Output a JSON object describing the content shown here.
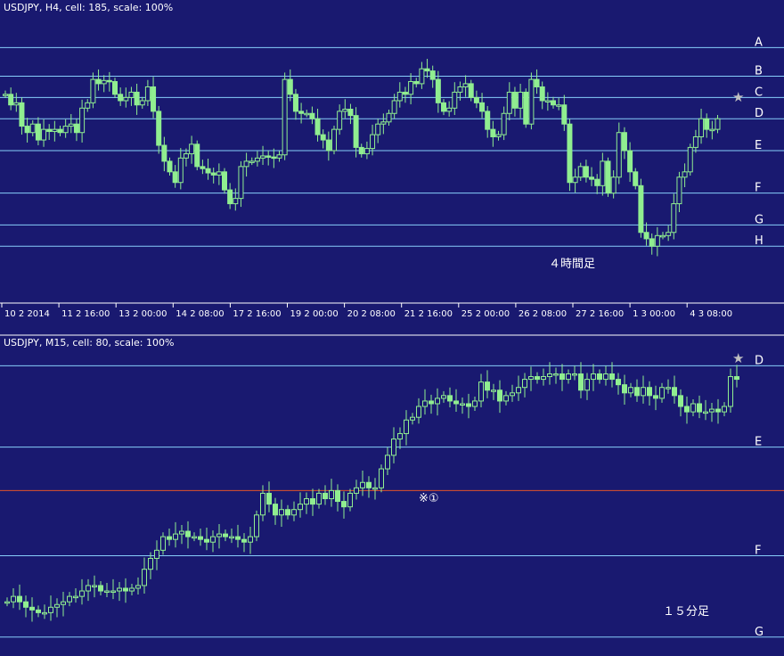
{
  "background_color": "#191970",
  "level_line_color": "#87cefa",
  "candle_color": "#90ee90",
  "star_color": "#c0c0c0",
  "marker_line_color": "#e0522a",
  "chart_data": [
    {
      "type": "candlestick",
      "header": "USDJPY, H4, cell: 185, scale: 100%",
      "annotation": "４時間足",
      "star": "★",
      "levels": [
        {
          "label": "A",
          "y": 0.92
        },
        {
          "label": "B",
          "y": 0.65
        },
        {
          "label": "C",
          "y": 0.45
        },
        {
          "label": "D",
          "y": 0.25
        },
        {
          "label": "E",
          "y": -0.05
        },
        {
          "label": "F",
          "y": -0.45
        },
        {
          "label": "G",
          "y": -0.75
        },
        {
          "label": "H",
          "y": -0.95
        }
      ],
      "ylim": [
        -1.25,
        1.2
      ],
      "x_labels": [
        "10 2 2014",
        "11 2 16:00",
        "13 2 00:00",
        "14 2 08:00",
        "17 2 16:00",
        "19 2 00:00",
        "20 2 08:00",
        "21 2 16:00",
        "25 2 00:00",
        "26 2 08:00",
        "27 2 16:00",
        "1 3 00:00",
        "4 3 08:00"
      ],
      "closes": [
        0.48,
        0.38,
        0.4,
        0.18,
        0.12,
        0.2,
        0.05,
        0.15,
        0.13,
        0.15,
        0.12,
        0.18,
        0.2,
        0.12,
        0.35,
        0.4,
        0.62,
        0.58,
        0.61,
        0.6,
        0.48,
        0.42,
        0.45,
        0.5,
        0.38,
        0.42,
        0.55,
        0.32,
        0.0,
        -0.15,
        -0.25,
        -0.35,
        -0.12,
        -0.08,
        0.01,
        -0.2,
        -0.22,
        -0.26,
        -0.28,
        -0.25,
        -0.42,
        -0.55,
        -0.5,
        -0.2,
        -0.15,
        -0.15,
        -0.12,
        -0.1,
        -0.11,
        -0.12,
        -0.09,
        0.62,
        0.48,
        0.32,
        0.3,
        0.3,
        0.25,
        0.1,
        0.05,
        -0.05,
        0.15,
        0.32,
        0.34,
        0.28,
        -0.02,
        -0.08,
        -0.03,
        0.1,
        0.2,
        0.22,
        0.3,
        0.42,
        0.5,
        0.48,
        0.6,
        0.58,
        0.72,
        0.7,
        0.62,
        0.4,
        0.32,
        0.35,
        0.5,
        0.55,
        0.58,
        0.45,
        0.4,
        0.32,
        0.15,
        0.08,
        0.1,
        0.3,
        0.5,
        0.35,
        0.5,
        0.2,
        0.62,
        0.55,
        0.42,
        0.42,
        0.38,
        0.38,
        0.2,
        -0.35,
        -0.3,
        -0.2,
        -0.3,
        -0.32,
        -0.38,
        -0.15,
        -0.45,
        -0.3,
        0.12,
        -0.05,
        -0.25,
        -0.38,
        -0.82,
        -0.88,
        -0.95,
        -0.85,
        -0.85,
        -0.82,
        -0.55,
        -0.3,
        -0.25,
        -0.02,
        0.08,
        0.25,
        0.15,
        0.15,
        0.25
      ]
    },
    {
      "type": "candlestick",
      "header": "USDJPY, M15, cell: 80, scale: 100%",
      "annotation": "１５分足",
      "marker_label": "※①",
      "star": "★",
      "levels": [
        {
          "label": "D",
          "y": 0.25
        },
        {
          "label": "E",
          "y": -0.05
        },
        {
          "label": "F",
          "y": -0.45
        },
        {
          "label": "G",
          "y": -0.75
        }
      ],
      "marker_line_y": -0.21,
      "ylim": [
        -0.8,
        0.33
      ],
      "closes": [
        -0.62,
        -0.6,
        -0.62,
        -0.64,
        -0.65,
        -0.66,
        -0.66,
        -0.64,
        -0.63,
        -0.62,
        -0.6,
        -0.6,
        -0.58,
        -0.56,
        -0.56,
        -0.58,
        -0.58,
        -0.58,
        -0.57,
        -0.58,
        -0.57,
        -0.56,
        -0.5,
        -0.46,
        -0.43,
        -0.38,
        -0.39,
        -0.37,
        -0.36,
        -0.38,
        -0.38,
        -0.39,
        -0.4,
        -0.38,
        -0.37,
        -0.38,
        -0.38,
        -0.39,
        -0.4,
        -0.38,
        -0.3,
        -0.22,
        -0.26,
        -0.3,
        -0.28,
        -0.3,
        -0.28,
        -0.26,
        -0.24,
        -0.26,
        -0.22,
        -0.24,
        -0.21,
        -0.25,
        -0.27,
        -0.22,
        -0.2,
        -0.18,
        -0.2,
        -0.2,
        -0.13,
        -0.08,
        -0.02,
        0.0,
        0.05,
        0.06,
        0.1,
        0.12,
        0.11,
        0.13,
        0.14,
        0.12,
        0.11,
        0.11,
        0.1,
        0.12,
        0.19,
        0.16,
        0.16,
        0.12,
        0.14,
        0.15,
        0.17,
        0.2,
        0.21,
        0.2,
        0.21,
        0.22,
        0.22,
        0.2,
        0.22,
        0.22,
        0.16,
        0.2,
        0.22,
        0.2,
        0.22,
        0.2,
        0.18,
        0.15,
        0.17,
        0.14,
        0.17,
        0.14,
        0.13,
        0.17,
        0.17,
        0.14,
        0.1,
        0.08,
        0.11,
        0.08,
        0.08,
        0.09,
        0.08,
        0.1,
        0.21,
        0.2
      ]
    }
  ]
}
